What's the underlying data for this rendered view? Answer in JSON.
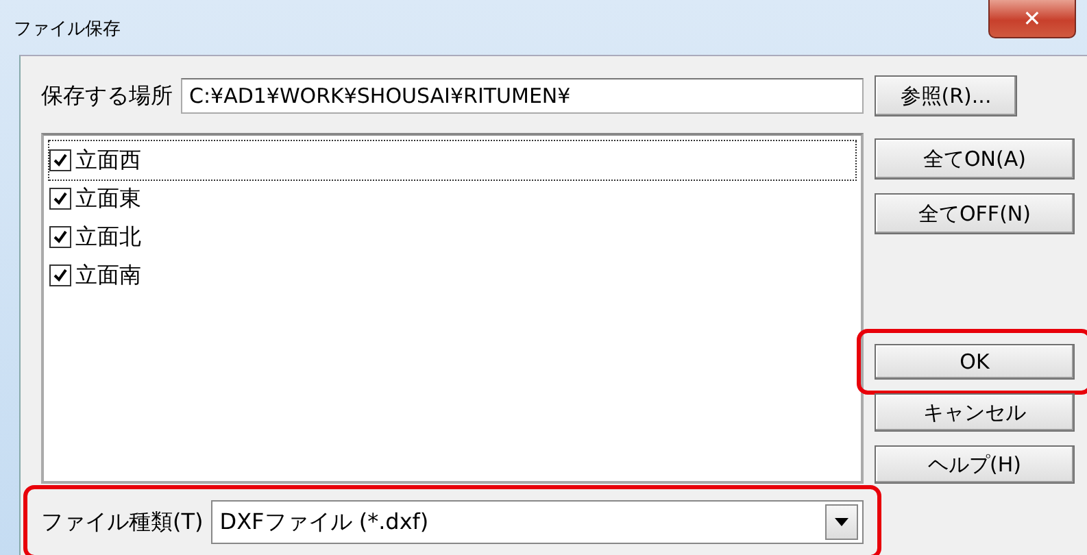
{
  "window": {
    "title": "ファイル保存",
    "close": "✕"
  },
  "location": {
    "label": "保存する場所",
    "value": "C:¥AD1¥WORK¥SHOUSAI¥RITUMEN¥",
    "browse": "参照(R)..."
  },
  "items": [
    {
      "label": "立面西",
      "checked": true,
      "focused": true
    },
    {
      "label": "立面東",
      "checked": true,
      "focused": false
    },
    {
      "label": "立面北",
      "checked": true,
      "focused": false
    },
    {
      "label": "立面南",
      "checked": true,
      "focused": false
    }
  ],
  "side_buttons": [
    {
      "label": "全てON(A)",
      "highlighted": false
    },
    {
      "label": "全てOFF(N)",
      "highlighted": false
    }
  ],
  "action_buttons": [
    {
      "label": "OK",
      "highlighted": true
    },
    {
      "label": "キャンセル",
      "highlighted": false
    },
    {
      "label": "ヘルプ(H)",
      "highlighted": false
    }
  ],
  "file_type": {
    "label": "ファイル種類(T)",
    "value": "DXFファイル (*.dxf)",
    "highlighted": true
  }
}
